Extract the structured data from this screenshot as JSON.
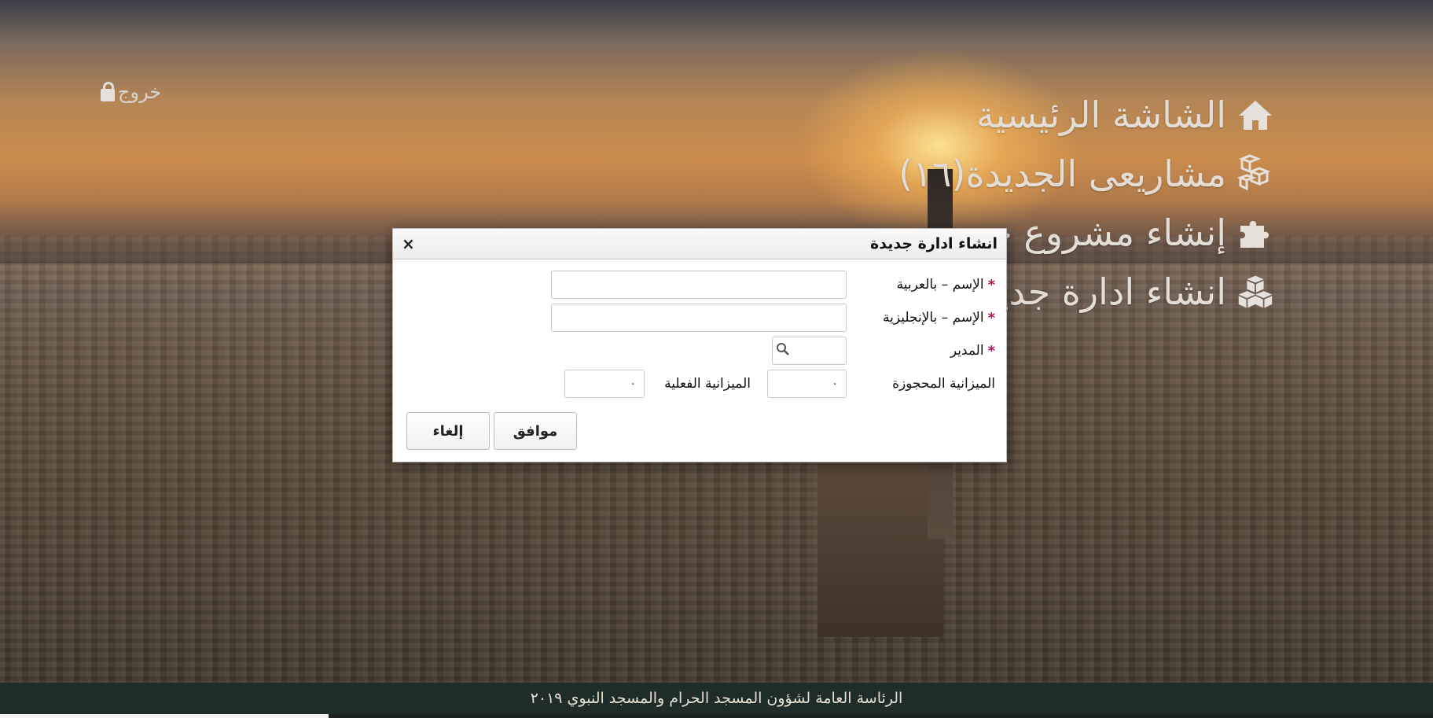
{
  "logout_label": "خروج",
  "menu": {
    "home": "الشاشة الرئيسية",
    "my_projects": "مشاريعى الجديدة(١٦)",
    "new_project": "إنشاء مشروع جديد",
    "new_department": "انشاء ادارة جديدة"
  },
  "modal": {
    "title": "انشاء ادارة جديدة",
    "close": "×",
    "required_mark": "*",
    "name_ar_label": "الإسم – بالعربية",
    "name_en_label": "الإسم – بالإنجليزية",
    "manager_label": "المدير",
    "reserved_budget_label": "الميزانية المحجوزة",
    "reserved_budget_value": "٠",
    "actual_budget_label": "الميزانية الفعلية",
    "actual_budget_value": "٠",
    "ok_label": "موافق",
    "cancel_label": "إلغاء"
  },
  "footer_text": "الرئاسة العامة لشؤون المسجد الحرام والمسجد النبوي ٢٠١٩"
}
